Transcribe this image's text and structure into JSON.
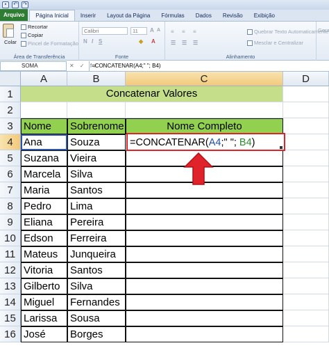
{
  "tabs": {
    "file": "Arquivo",
    "items": [
      "Página Inicial",
      "Inserir",
      "Layout da Página",
      "Fórmulas",
      "Dados",
      "Revisão",
      "Exibição"
    ]
  },
  "ribbon": {
    "clipboard": {
      "paste": "Colar",
      "cut": "Recortar",
      "copy": "Copiar",
      "format_painter": "Pincel de Formatação",
      "label": "Área de Transferência"
    },
    "font": {
      "name": "Calibri",
      "size": "11",
      "label": "Fonte"
    },
    "alignment": {
      "wrap": "Quebrar Texto Automaticamente",
      "merge": "Mesclar e Centralizar",
      "label": "Alinhamento"
    },
    "general": "Geral"
  },
  "formula_bar": {
    "name_box": "SOMA",
    "icons": "✕ ✓ fx",
    "formula": "=CONCATENAR(A4;\" \"; B4)"
  },
  "columns": [
    "A",
    "B",
    "C",
    "D"
  ],
  "rows": [
    "1",
    "2",
    "3",
    "4",
    "5",
    "6",
    "7",
    "8",
    "9",
    "10",
    "11",
    "12",
    "13",
    "14",
    "15",
    "16"
  ],
  "sheet": {
    "title": "Concatenar Valores",
    "headers": {
      "a": "Nome",
      "b": "Sobrenome",
      "c": "Nome Completo"
    },
    "formula_parts": {
      "prefix": "=CONCATENAR(",
      "ref_a": "A4",
      "middle": ";\" \"; ",
      "ref_b": "B4",
      "suffix": ")"
    },
    "data": [
      {
        "nome": "Ana",
        "sobrenome": "Souza"
      },
      {
        "nome": "Suzana",
        "sobrenome": "Vieira"
      },
      {
        "nome": "Marcela",
        "sobrenome": "Silva"
      },
      {
        "nome": "Maria",
        "sobrenome": "Santos"
      },
      {
        "nome": "Pedro",
        "sobrenome": "Lima"
      },
      {
        "nome": "Eliana",
        "sobrenome": "Pereira"
      },
      {
        "nome": "Edson",
        "sobrenome": "Ferreira"
      },
      {
        "nome": "Mateus",
        "sobrenome": "Junqueira"
      },
      {
        "nome": "Vitoria",
        "sobrenome": "Santos"
      },
      {
        "nome": "Gilberto",
        "sobrenome": "Silva"
      },
      {
        "nome": "Miguel",
        "sobrenome": "Fernandes"
      },
      {
        "nome": "Larissa",
        "sobrenome": "Sousa"
      },
      {
        "nome": "José",
        "sobrenome": "Borges"
      }
    ]
  },
  "colors": {
    "title_fill": "#c5de8a",
    "header_fill": "#92d050",
    "highlight": "#e0222a",
    "arrow": "#e0222a"
  }
}
